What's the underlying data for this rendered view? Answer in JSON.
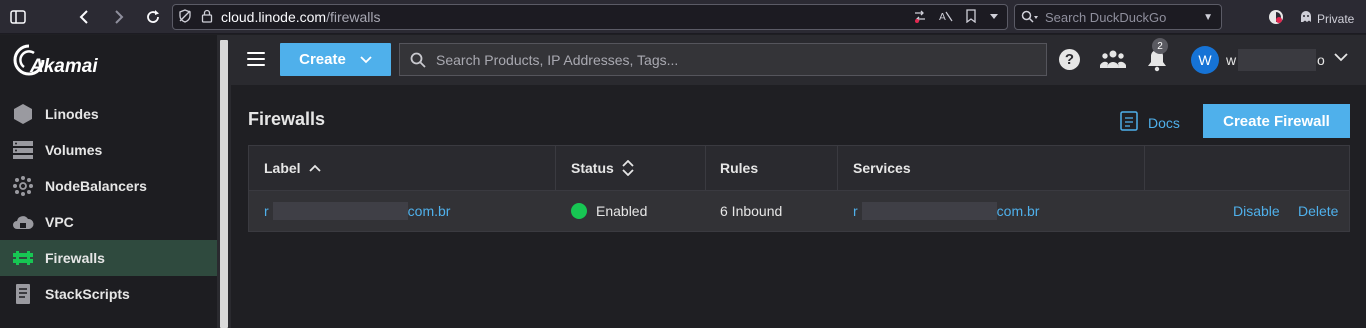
{
  "browser": {
    "url_host": "cloud.linode.com",
    "url_path": "/firewalls",
    "search_placeholder": "Search DuckDuckGo",
    "private_label": "Private"
  },
  "sidebar": {
    "brand": "Akamai",
    "items": [
      {
        "label": "Linodes",
        "icon": "linodes-icon"
      },
      {
        "label": "Volumes",
        "icon": "volumes-icon"
      },
      {
        "label": "NodeBalancers",
        "icon": "nodebalancers-icon"
      },
      {
        "label": "VPC",
        "icon": "vpc-icon"
      },
      {
        "label": "Firewalls",
        "icon": "firewalls-icon",
        "active": true
      },
      {
        "label": "StackScripts",
        "icon": "stackscripts-icon"
      }
    ]
  },
  "topbar": {
    "create_label": "Create",
    "search_placeholder": "Search Products, IP Addresses, Tags...",
    "notification_count": "2",
    "avatar_initial": "W",
    "username_start": "w",
    "username_end": "o"
  },
  "page": {
    "title": "Firewalls",
    "docs_label": "Docs",
    "create_button_label": "Create Firewall"
  },
  "table": {
    "headers": {
      "label": "Label",
      "status": "Status",
      "rules": "Rules",
      "services": "Services"
    },
    "rows": [
      {
        "label_start": "r",
        "label_end": "com.br",
        "status": "Enabled",
        "rules": "6 Inbound",
        "services_start": "r",
        "services_end": "com.br",
        "action_disable": "Disable",
        "action_delete": "Delete"
      }
    ]
  },
  "colors": {
    "accent": "#4fb0eb",
    "status_enabled": "#17c653",
    "active_nav": "#2f4a3e"
  }
}
